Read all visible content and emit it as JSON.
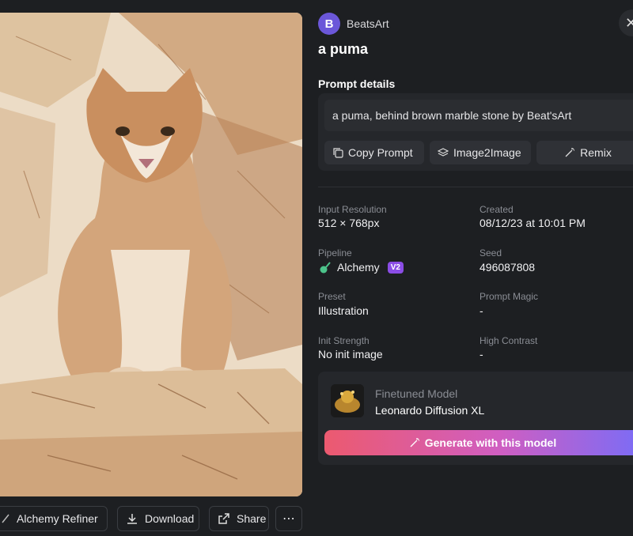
{
  "user": {
    "initial": "B",
    "name": "BeatsArt"
  },
  "image": {
    "title": "a puma",
    "alt": "a puma illustration"
  },
  "prompt_section": {
    "heading": "Prompt details",
    "text": "a puma, behind brown marble stone by Beat'sArt",
    "buttons": {
      "copy": "Copy Prompt",
      "image2image": "Image2Image",
      "remix": "Remix"
    }
  },
  "meta": {
    "input_resolution": {
      "label": "Input Resolution",
      "value": "512 × 768px"
    },
    "created": {
      "label": "Created",
      "value": "08/12/23 at 10:01 PM"
    },
    "pipeline": {
      "label": "Pipeline",
      "value": "Alchemy",
      "badge": "V2"
    },
    "seed": {
      "label": "Seed",
      "value": "496087808"
    },
    "preset": {
      "label": "Preset",
      "value": "Illustration"
    },
    "prompt_magic": {
      "label": "Prompt Magic",
      "value": "-"
    },
    "init_strength": {
      "label": "Init Strength",
      "value": "No init image"
    },
    "high_contrast": {
      "label": "High Contrast",
      "value": "-"
    }
  },
  "model": {
    "label": "Finetuned Model",
    "name": "Leonardo Diffusion XL",
    "generate_label": "Generate with this model"
  },
  "actions": {
    "alchemy_refiner": "Alchemy Refiner",
    "download": "Download",
    "share": "Share",
    "more": "⋯"
  },
  "colors": {
    "background": "#1d1f22",
    "panel": "#25272b",
    "avatar": "#6b57d9",
    "badge": "#8b4de6",
    "gradient_start": "#ec5a6f",
    "gradient_end": "#7b6cf6"
  }
}
